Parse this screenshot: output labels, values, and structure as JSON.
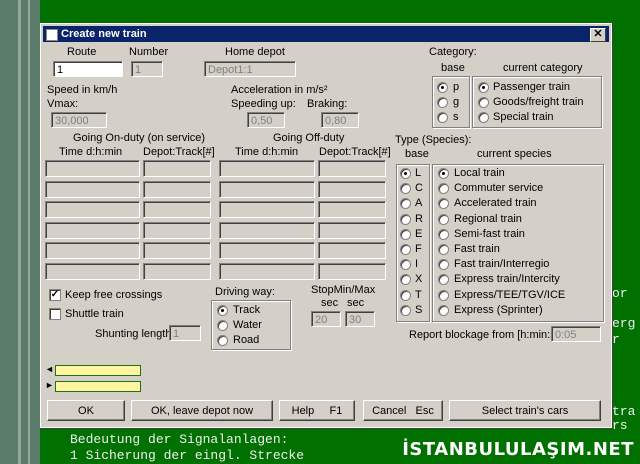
{
  "window": {
    "title": "Create new train"
  },
  "route": {
    "label": "Route",
    "value": "1"
  },
  "number": {
    "label": "Number",
    "value": "1"
  },
  "home_depot": {
    "label": "Home depot",
    "value": "Depot1:1"
  },
  "speed": {
    "label": "Speed in km/h",
    "vmax_label": "Vmax:",
    "vmax_value": "30,000"
  },
  "acceleration": {
    "label": "Acceleration in m/s²",
    "up_label": "Speeding up:",
    "up_value": "0,50",
    "brake_label": "Braking:",
    "brake_value": "0,80"
  },
  "category": {
    "label": "Category:",
    "base_label": "base",
    "current_label": "current category",
    "base_options": [
      {
        "label": "p",
        "selected": true
      },
      {
        "label": "g",
        "selected": false
      },
      {
        "label": "s",
        "selected": false
      }
    ],
    "current_options": [
      {
        "label": "Passenger train",
        "selected": true
      },
      {
        "label": "Goods/freight train",
        "selected": false
      },
      {
        "label": "Special train",
        "selected": false
      }
    ]
  },
  "on_duty": {
    "title": "Going On-duty (on service)",
    "time_header": "Time  d:h:min",
    "depot_header": "Depot:Track[#]"
  },
  "off_duty": {
    "title": "Going Off-duty",
    "time_header": "Time  d:h:min",
    "depot_header": "Depot:Track[#]"
  },
  "species": {
    "label": "Type (Species):",
    "base_label": "base",
    "current_label": "current species",
    "base_options": [
      {
        "label": "L",
        "selected": true
      },
      {
        "label": "C",
        "selected": false
      },
      {
        "label": "A",
        "selected": false
      },
      {
        "label": "R",
        "selected": false
      },
      {
        "label": "E",
        "selected": false
      },
      {
        "label": "F",
        "selected": false
      },
      {
        "label": "I",
        "selected": false
      },
      {
        "label": "X",
        "selected": false
      },
      {
        "label": "T",
        "selected": false
      },
      {
        "label": "S",
        "selected": false
      }
    ],
    "current_options": [
      {
        "label": "Local train",
        "selected": true
      },
      {
        "label": "Commuter service",
        "selected": false
      },
      {
        "label": "Accelerated train",
        "selected": false
      },
      {
        "label": "Regional train",
        "selected": false
      },
      {
        "label": "Semi-fast train",
        "selected": false
      },
      {
        "label": "Fast train",
        "selected": false
      },
      {
        "label": "Fast train/Interregio",
        "selected": false
      },
      {
        "label": "Express train/Intercity",
        "selected": false
      },
      {
        "label": "Express/TEE/TGV/ICE",
        "selected": false
      },
      {
        "label": "Express (Sprinter)",
        "selected": false
      }
    ]
  },
  "options": {
    "keep_free": {
      "label": "Keep free crossings",
      "checked": true,
      "mark": "✓"
    },
    "shuttle": {
      "label": "Shuttle train",
      "checked": false
    },
    "shunting": {
      "label": "Shunting length:",
      "value": "1"
    }
  },
  "driving_way": {
    "label": "Driving way:",
    "options": [
      {
        "label": "Track",
        "selected": true
      },
      {
        "label": "Water",
        "selected": false
      },
      {
        "label": "Road",
        "selected": false
      }
    ]
  },
  "stop": {
    "label": "StopMin/Max",
    "sec1": "sec",
    "sec2": "sec",
    "min_value": "20",
    "max_value": "30"
  },
  "report": {
    "label": "Report blockage from [h:min:s]:",
    "value": "0:05"
  },
  "buttons": {
    "ok": "OK",
    "ok_leave": "OK, leave depot now",
    "help": "Help",
    "help_key": "F1",
    "cancel": "Cancel",
    "cancel_key": "Esc",
    "select_cars": "Select train's cars"
  },
  "background": {
    "line1": "Bedeutung der Signalanlagen:",
    "line2": "1 Sicherung der eingl. Strecke",
    "right1": "or",
    "right2": "erg",
    "right3": "r",
    "right4": "tra",
    "right5": "rs"
  },
  "watermark": "İSTANBULULAŞIM.NET"
}
